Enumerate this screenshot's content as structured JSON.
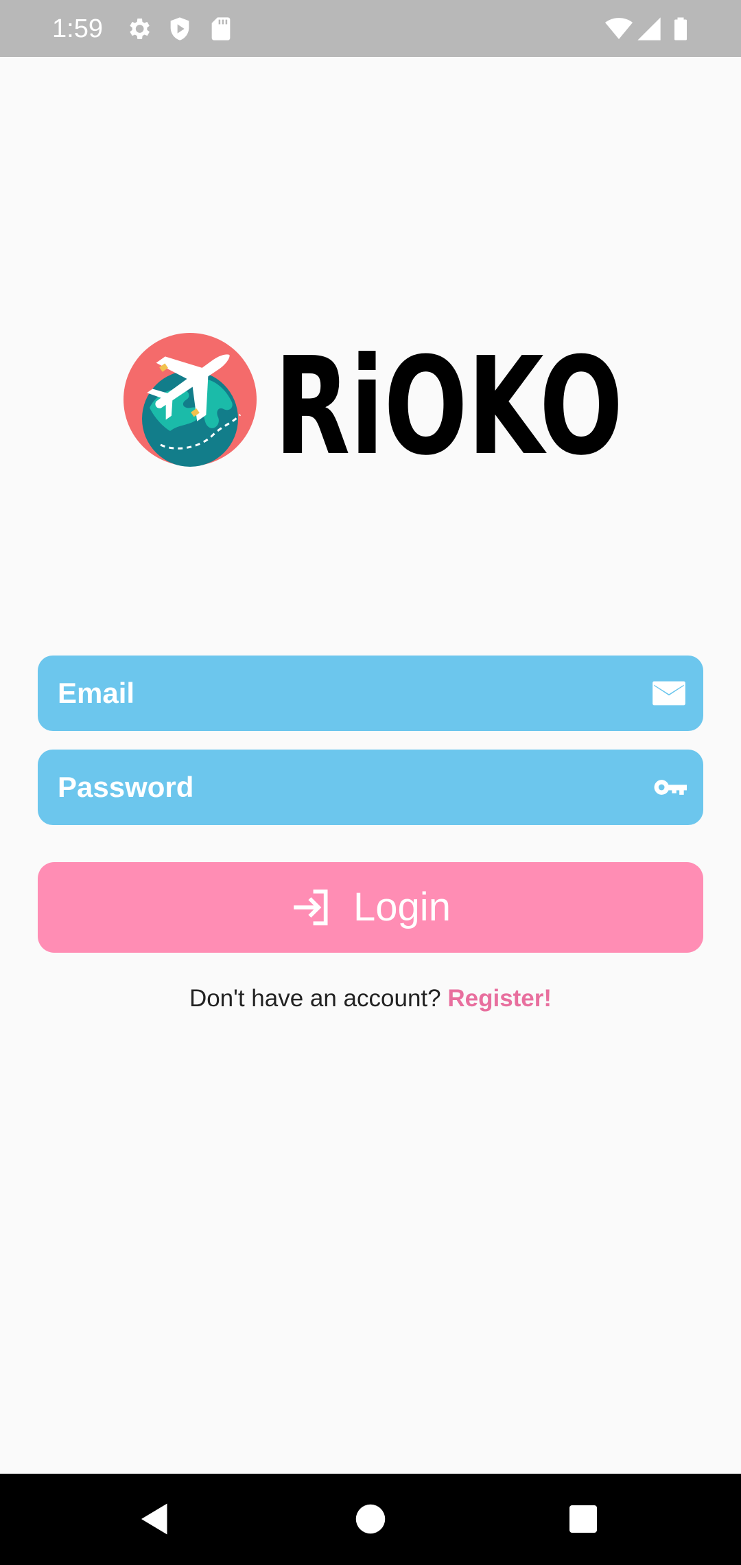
{
  "status_bar": {
    "time": "1:59",
    "left_icons": [
      "gear-icon",
      "shield-play-icon",
      "sd-card-icon"
    ],
    "right_icons": [
      "wifi-icon",
      "signal-icon",
      "battery-icon"
    ]
  },
  "logo": {
    "text": "RiOKO",
    "colors": {
      "circle": "#f46b6b",
      "globe": "#127d8a",
      "land": "#1bbba9",
      "plane": "#ffffff",
      "wordmark": "#000000"
    }
  },
  "form": {
    "email": {
      "placeholder": "Email",
      "icon": "mail-icon"
    },
    "password": {
      "placeholder": "Password",
      "icon": "key-icon"
    },
    "login_button": {
      "label": "Login",
      "icon": "login-arrow-icon"
    },
    "register_prompt": "Don't have an account?",
    "register_link": "Register!"
  },
  "colors": {
    "input_bg": "#6cc6ed",
    "button_bg": "#ff8db4",
    "link": "#e86f9e",
    "background": "#fafafa",
    "status_bar": "#b8b8b8"
  },
  "nav_bar": {
    "buttons": [
      "back-icon",
      "home-icon",
      "recents-icon"
    ]
  }
}
